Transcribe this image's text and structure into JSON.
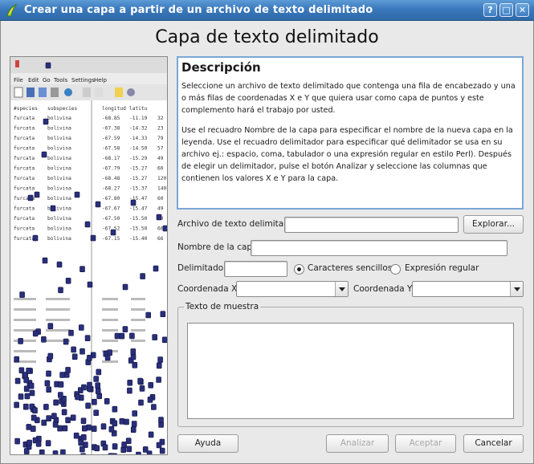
{
  "window": {
    "title": "Crear una capa a partir de un archivo de texto delimitado",
    "controls": [
      "?",
      "□",
      "✕"
    ]
  },
  "heading": "Capa de texto delimitado",
  "preview": {
    "menu": [
      "File",
      "Edit",
      "Go",
      "Tools",
      "Settings",
      "Help"
    ],
    "columns": [
      "#species",
      "subspecies",
      "longitud",
      "latitu"
    ],
    "rows": [
      [
        "furcata",
        "bolivina",
        "-68.85",
        "-11.19",
        "32"
      ],
      [
        "furcata",
        "bolivina",
        "-67.38",
        "-14.32",
        "23"
      ],
      [
        "furcata",
        "bolivina",
        "-67.59",
        "-14.33",
        "79"
      ],
      [
        "furcata",
        "bolivina",
        "-67.58",
        "-14.50",
        "57"
      ],
      [
        "furcata",
        "bolivina",
        "-68.17",
        "-15.29",
        "49"
      ],
      [
        "furcata",
        "bolivina",
        "-67.79",
        "-15.27",
        "60"
      ],
      [
        "furcata",
        "bolivina",
        "-68.48",
        "-15.27",
        "120"
      ],
      [
        "furcata",
        "bolivina",
        "-68.27",
        "-15.37",
        "140"
      ],
      [
        "furcata",
        "bolivina",
        "-67.80",
        "-15.47",
        "60"
      ],
      [
        "furcata",
        "bolivina",
        "-67.67",
        "-15.47",
        "49"
      ],
      [
        "furcata",
        "bolivina",
        "-67.50",
        "-15.50",
        "60"
      ],
      [
        "furcata",
        "bolivina",
        "-67.52",
        "-15.50",
        "60"
      ],
      [
        "furcata",
        "bolivina",
        "-67.15",
        "-15.40",
        "66"
      ]
    ]
  },
  "description": {
    "title": "Descripción",
    "p1": "Seleccione un archivo de texto delimitado que contenga una fila de encabezado y una o más filas de coordenadas X e Y que quiera usar como capa de puntos y este complemento hará el trabajo por usted.",
    "p2": "Use el recuadro Nombre de la capa para especificar el nombre de la nueva capa en la leyenda. Use el recuadro delimitador para especificar qué delimitador se usa en su archivo ej.: espacio, coma, tabulador o una expresión regular en estilo Perl). Después de elegir un delimitador, pulse el botón Analizar y seleccione las columnas que contienen los valores X e Y para la capa."
  },
  "form": {
    "file_label": "Archivo de texto delimitado",
    "file_value": "",
    "browse_label": "Explorar...",
    "layer_name_label": "Nombre de la capa",
    "layer_name_value": "",
    "delimiter_label": "Delimitador",
    "delimiter_value": "",
    "radio_simple": "Caracteres sencillos",
    "radio_regex": "Expresión regular",
    "x_label": "Coordenada X",
    "y_label": "Coordenada Y",
    "sample_label": "Texto de muestra"
  },
  "buttons": {
    "help": "Ayuda",
    "parse": "Analizar",
    "accept": "Aceptar",
    "cancel": "Cancelar"
  }
}
